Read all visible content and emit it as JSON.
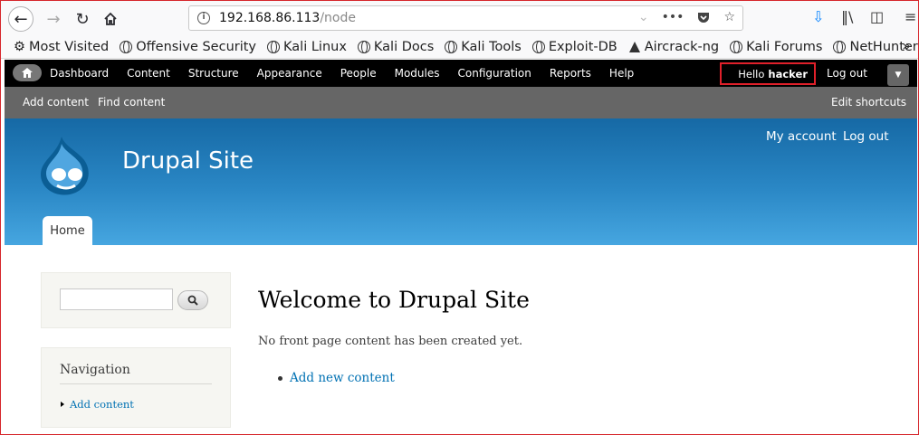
{
  "browser": {
    "url_host": "192.168.86.113",
    "url_path": "/node",
    "bookmarks": [
      "Most Visited",
      "Offensive Security",
      "Kali Linux",
      "Kali Docs",
      "Kali Tools",
      "Exploit-DB",
      "Aircrack-ng",
      "Kali Forums",
      "NetHunter"
    ],
    "more_bookmarks": "»"
  },
  "admin_toolbar": {
    "menu": [
      "Dashboard",
      "Content",
      "Structure",
      "Appearance",
      "People",
      "Modules",
      "Configuration",
      "Reports",
      "Help"
    ],
    "hello_prefix": "Hello",
    "username": "hacker",
    "logout": "Log out"
  },
  "shortcuts": {
    "add_content": "Add content",
    "find_content": "Find content",
    "edit_shortcuts": "Edit shortcuts"
  },
  "header": {
    "site_name": "Drupal Site",
    "my_account": "My account",
    "logout": "Log out",
    "home_tab": "Home"
  },
  "sidebar": {
    "search_value": "",
    "nav_title": "Navigation",
    "nav_items": [
      "Add content"
    ]
  },
  "main": {
    "title": "Welcome to Drupal Site",
    "message": "No front page content has been created yet.",
    "add_link": "Add new content"
  }
}
